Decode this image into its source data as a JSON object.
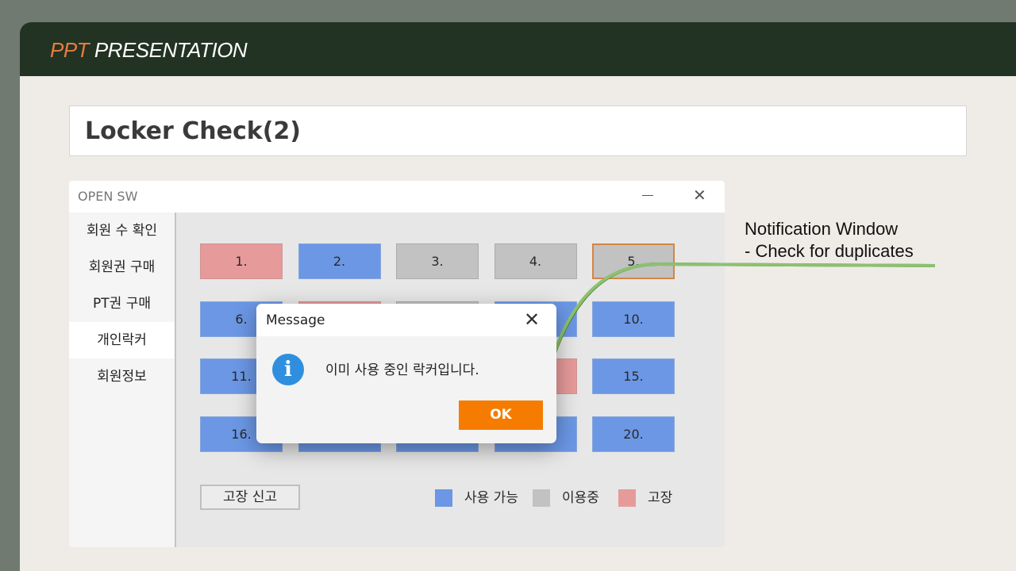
{
  "slide": {
    "brand_accent": "PPT",
    "brand_rest": "PRESENTATION",
    "title": "Locker Check(2)",
    "annotation_line1": "Notification Window",
    "annotation_line2": "- Check for duplicates"
  },
  "app": {
    "window_title": "OPEN SW",
    "sidebar": [
      {
        "label": "회원 수 확인",
        "active": false
      },
      {
        "label": "회원권 구매",
        "active": false
      },
      {
        "label": "PT권 구매",
        "active": false
      },
      {
        "label": "개인락커",
        "active": true
      },
      {
        "label": "회원정보",
        "active": false
      }
    ],
    "lockers": [
      {
        "label": "1.",
        "status": "broken"
      },
      {
        "label": "2.",
        "status": "available"
      },
      {
        "label": "3.",
        "status": "in_use"
      },
      {
        "label": "4.",
        "status": "in_use"
      },
      {
        "label": "5.",
        "status": "in_use",
        "focused": true
      },
      {
        "label": "6.",
        "status": "available"
      },
      {
        "label": "",
        "status": "broken"
      },
      {
        "label": "",
        "status": "in_use"
      },
      {
        "label": "",
        "status": "available"
      },
      {
        "label": "10.",
        "status": "available"
      },
      {
        "label": "11.",
        "status": "available"
      },
      {
        "label": "",
        "status": "available"
      },
      {
        "label": "",
        "status": "available"
      },
      {
        "label": "",
        "status": "broken"
      },
      {
        "label": "15.",
        "status": "available"
      },
      {
        "label": "16.",
        "status": "available"
      },
      {
        "label": "",
        "status": "available"
      },
      {
        "label": "",
        "status": "available"
      },
      {
        "label": "",
        "status": "available"
      },
      {
        "label": "20.",
        "status": "available"
      }
    ],
    "report_button": "고장 신고",
    "legend": [
      {
        "label": "사용 가능",
        "color": "#6b9cf3"
      },
      {
        "label": "이용중",
        "color": "#cccccc"
      },
      {
        "label": "고장",
        "color": "#f5a0a0"
      }
    ]
  },
  "dialog": {
    "title": "Message",
    "message": "이미 사용 중인 락커입니다.",
    "ok_label": "OK",
    "icon": "info-icon"
  },
  "colors": {
    "header_bg": "#233323",
    "accent_orange": "#f57c00",
    "connector_green": "#8dc071"
  }
}
